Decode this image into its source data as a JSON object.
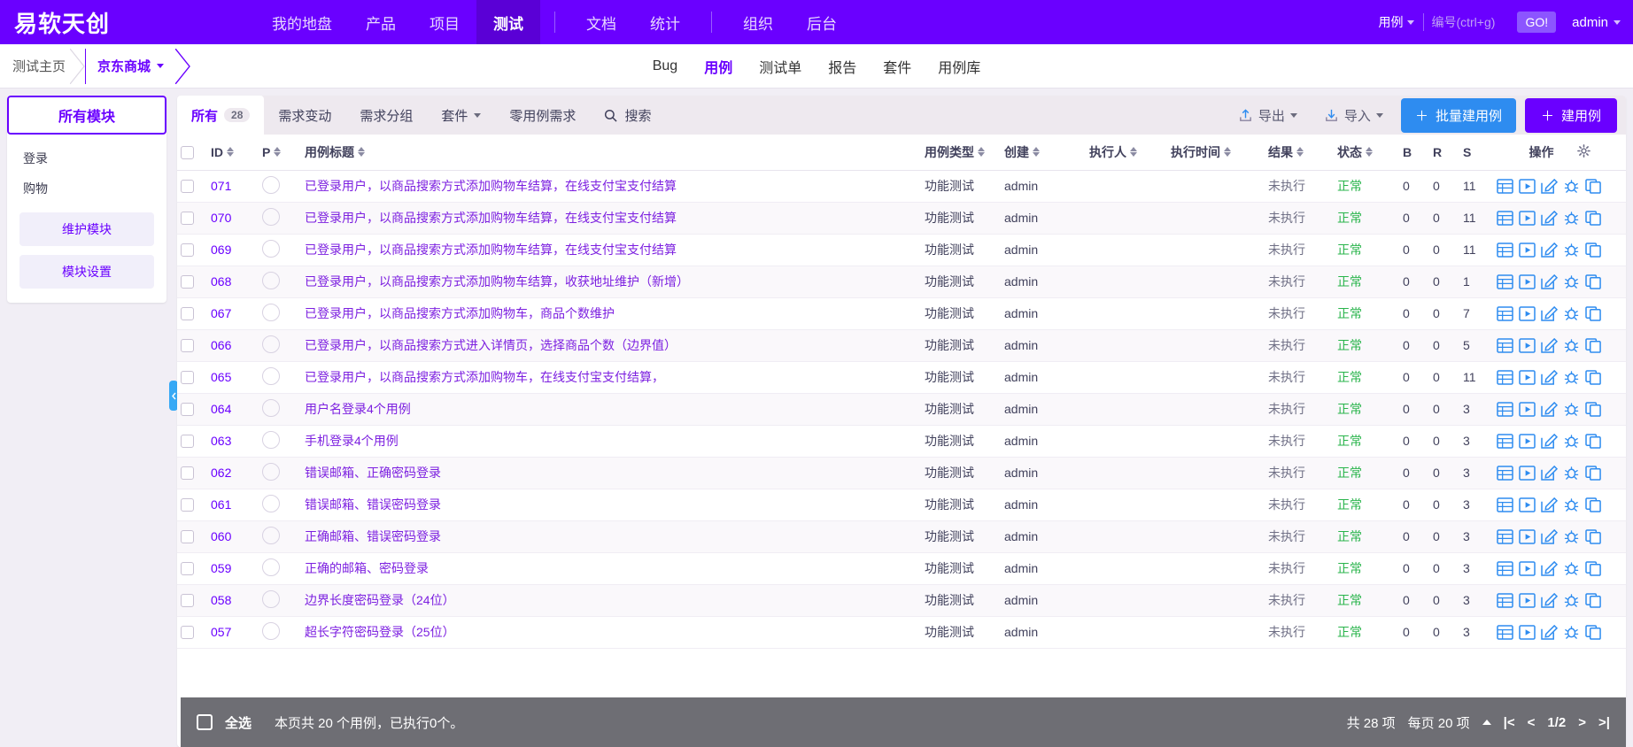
{
  "topbar": {
    "brand": "易软天创",
    "nav": [
      {
        "label": "我的地盘",
        "active": false
      },
      {
        "label": "产品",
        "active": false
      },
      {
        "label": "项目",
        "active": false
      },
      {
        "label": "测试",
        "active": true
      },
      {
        "label": "文档",
        "active": false
      },
      {
        "label": "统计",
        "active": false
      },
      {
        "label": "组织",
        "active": false
      },
      {
        "label": "后台",
        "active": false
      }
    ],
    "search_type": "用例",
    "search_placeholder": "编号(ctrl+g)",
    "search_value": "",
    "go_label": "GO!",
    "user": "admin",
    "accent": "#6a00ff"
  },
  "breadcrumb": {
    "items": [
      {
        "label": "测试主页",
        "active": false
      },
      {
        "label": "京东商城",
        "active": true
      }
    ]
  },
  "subnav": [
    {
      "label": "Bug",
      "active": false
    },
    {
      "label": "用例",
      "active": true
    },
    {
      "label": "测试单",
      "active": false
    },
    {
      "label": "报告",
      "active": false
    },
    {
      "label": "套件",
      "active": false
    },
    {
      "label": "用例库",
      "active": false
    }
  ],
  "sidebar": {
    "title": "所有模块",
    "items": [
      {
        "label": "登录"
      },
      {
        "label": "购物"
      }
    ],
    "buttons": [
      {
        "label": "维护模块"
      },
      {
        "label": "模块设置"
      }
    ]
  },
  "toolbar": {
    "tabs": [
      {
        "label": "所有",
        "count": "28",
        "active": true
      },
      {
        "label": "需求变动",
        "count": "",
        "active": false
      },
      {
        "label": "需求分组",
        "count": "",
        "active": false
      },
      {
        "label": "套件",
        "count": "",
        "active": false,
        "caret": true
      },
      {
        "label": "零用例需求",
        "count": "",
        "active": false
      }
    ],
    "search_label": "搜索",
    "export_label": "导出",
    "import_label": "导入",
    "batch_create_label": "批量建用例",
    "create_label": "建用例"
  },
  "table": {
    "columns": [
      {
        "label": "ID",
        "sortable": true
      },
      {
        "label": "P",
        "sortable": true
      },
      {
        "label": "用例标题",
        "sortable": true
      },
      {
        "label": "用例类型",
        "sortable": true
      },
      {
        "label": "创建",
        "sortable": true
      },
      {
        "label": "执行人",
        "sortable": true
      },
      {
        "label": "执行时间",
        "sortable": true
      },
      {
        "label": "结果",
        "sortable": true
      },
      {
        "label": "状态",
        "sortable": true
      },
      {
        "label": "B",
        "sortable": false
      },
      {
        "label": "R",
        "sortable": false
      },
      {
        "label": "S",
        "sortable": false
      },
      {
        "label": "操作",
        "sortable": false
      }
    ],
    "rows": [
      {
        "id": "071",
        "title": "已登录用户，以商品搜索方式添加购物车结算，在线支付宝支付结算",
        "type": "功能测试",
        "creator": "admin",
        "executor": "",
        "exectime": "",
        "result": "未执行",
        "status": "正常",
        "b": "0",
        "r": "0",
        "s": "11"
      },
      {
        "id": "070",
        "title": "已登录用户，以商品搜索方式添加购物车结算，在线支付宝支付结算",
        "type": "功能测试",
        "creator": "admin",
        "executor": "",
        "exectime": "",
        "result": "未执行",
        "status": "正常",
        "b": "0",
        "r": "0",
        "s": "11"
      },
      {
        "id": "069",
        "title": "已登录用户，以商品搜索方式添加购物车结算，在线支付宝支付结算",
        "type": "功能测试",
        "creator": "admin",
        "executor": "",
        "exectime": "",
        "result": "未执行",
        "status": "正常",
        "b": "0",
        "r": "0",
        "s": "11"
      },
      {
        "id": "068",
        "title": "已登录用户，以商品搜索方式添加购物车结算，收获地址维护（新增）",
        "type": "功能测试",
        "creator": "admin",
        "executor": "",
        "exectime": "",
        "result": "未执行",
        "status": "正常",
        "b": "0",
        "r": "0",
        "s": "1"
      },
      {
        "id": "067",
        "title": "已登录用户，以商品搜索方式添加购物车，商品个数维护",
        "type": "功能测试",
        "creator": "admin",
        "executor": "",
        "exectime": "",
        "result": "未执行",
        "status": "正常",
        "b": "0",
        "r": "0",
        "s": "7"
      },
      {
        "id": "066",
        "title": "已登录用户，以商品搜索方式进入详情页，选择商品个数（边界值）",
        "type": "功能测试",
        "creator": "admin",
        "executor": "",
        "exectime": "",
        "result": "未执行",
        "status": "正常",
        "b": "0",
        "r": "0",
        "s": "5"
      },
      {
        "id": "065",
        "title": "已登录用户，以商品搜索方式添加购物车，在线支付宝支付结算，",
        "type": "功能测试",
        "creator": "admin",
        "executor": "",
        "exectime": "",
        "result": "未执行",
        "status": "正常",
        "b": "0",
        "r": "0",
        "s": "11"
      },
      {
        "id": "064",
        "title": "用户名登录4个用例",
        "type": "功能测试",
        "creator": "admin",
        "executor": "",
        "exectime": "",
        "result": "未执行",
        "status": "正常",
        "b": "0",
        "r": "0",
        "s": "3"
      },
      {
        "id": "063",
        "title": "手机登录4个用例",
        "type": "功能测试",
        "creator": "admin",
        "executor": "",
        "exectime": "",
        "result": "未执行",
        "status": "正常",
        "b": "0",
        "r": "0",
        "s": "3"
      },
      {
        "id": "062",
        "title": "错误邮箱、正确密码登录",
        "type": "功能测试",
        "creator": "admin",
        "executor": "",
        "exectime": "",
        "result": "未执行",
        "status": "正常",
        "b": "0",
        "r": "0",
        "s": "3"
      },
      {
        "id": "061",
        "title": "错误邮箱、错误密码登录",
        "type": "功能测试",
        "creator": "admin",
        "executor": "",
        "exectime": "",
        "result": "未执行",
        "status": "正常",
        "b": "0",
        "r": "0",
        "s": "3"
      },
      {
        "id": "060",
        "title": "正确邮箱、错误密码登录",
        "type": "功能测试",
        "creator": "admin",
        "executor": "",
        "exectime": "",
        "result": "未执行",
        "status": "正常",
        "b": "0",
        "r": "0",
        "s": "3"
      },
      {
        "id": "059",
        "title": "正确的邮箱、密码登录",
        "type": "功能测试",
        "creator": "admin",
        "executor": "",
        "exectime": "",
        "result": "未执行",
        "status": "正常",
        "b": "0",
        "r": "0",
        "s": "3"
      },
      {
        "id": "058",
        "title": "边界长度密码登录（24位）",
        "type": "功能测试",
        "creator": "admin",
        "executor": "",
        "exectime": "",
        "result": "未执行",
        "status": "正常",
        "b": "0",
        "r": "0",
        "s": "3"
      },
      {
        "id": "057",
        "title": "超长字符密码登录（25位）",
        "type": "功能测试",
        "creator": "admin",
        "executor": "",
        "exectime": "",
        "result": "未执行",
        "status": "正常",
        "b": "0",
        "r": "0",
        "s": "3"
      }
    ]
  },
  "footer": {
    "select_all": "全选",
    "summary": "本页共 20 个用例，已执行0个。",
    "total_label": "共 28 项",
    "per_page_label": "每页 20 项",
    "page_indicator": "1/2"
  }
}
